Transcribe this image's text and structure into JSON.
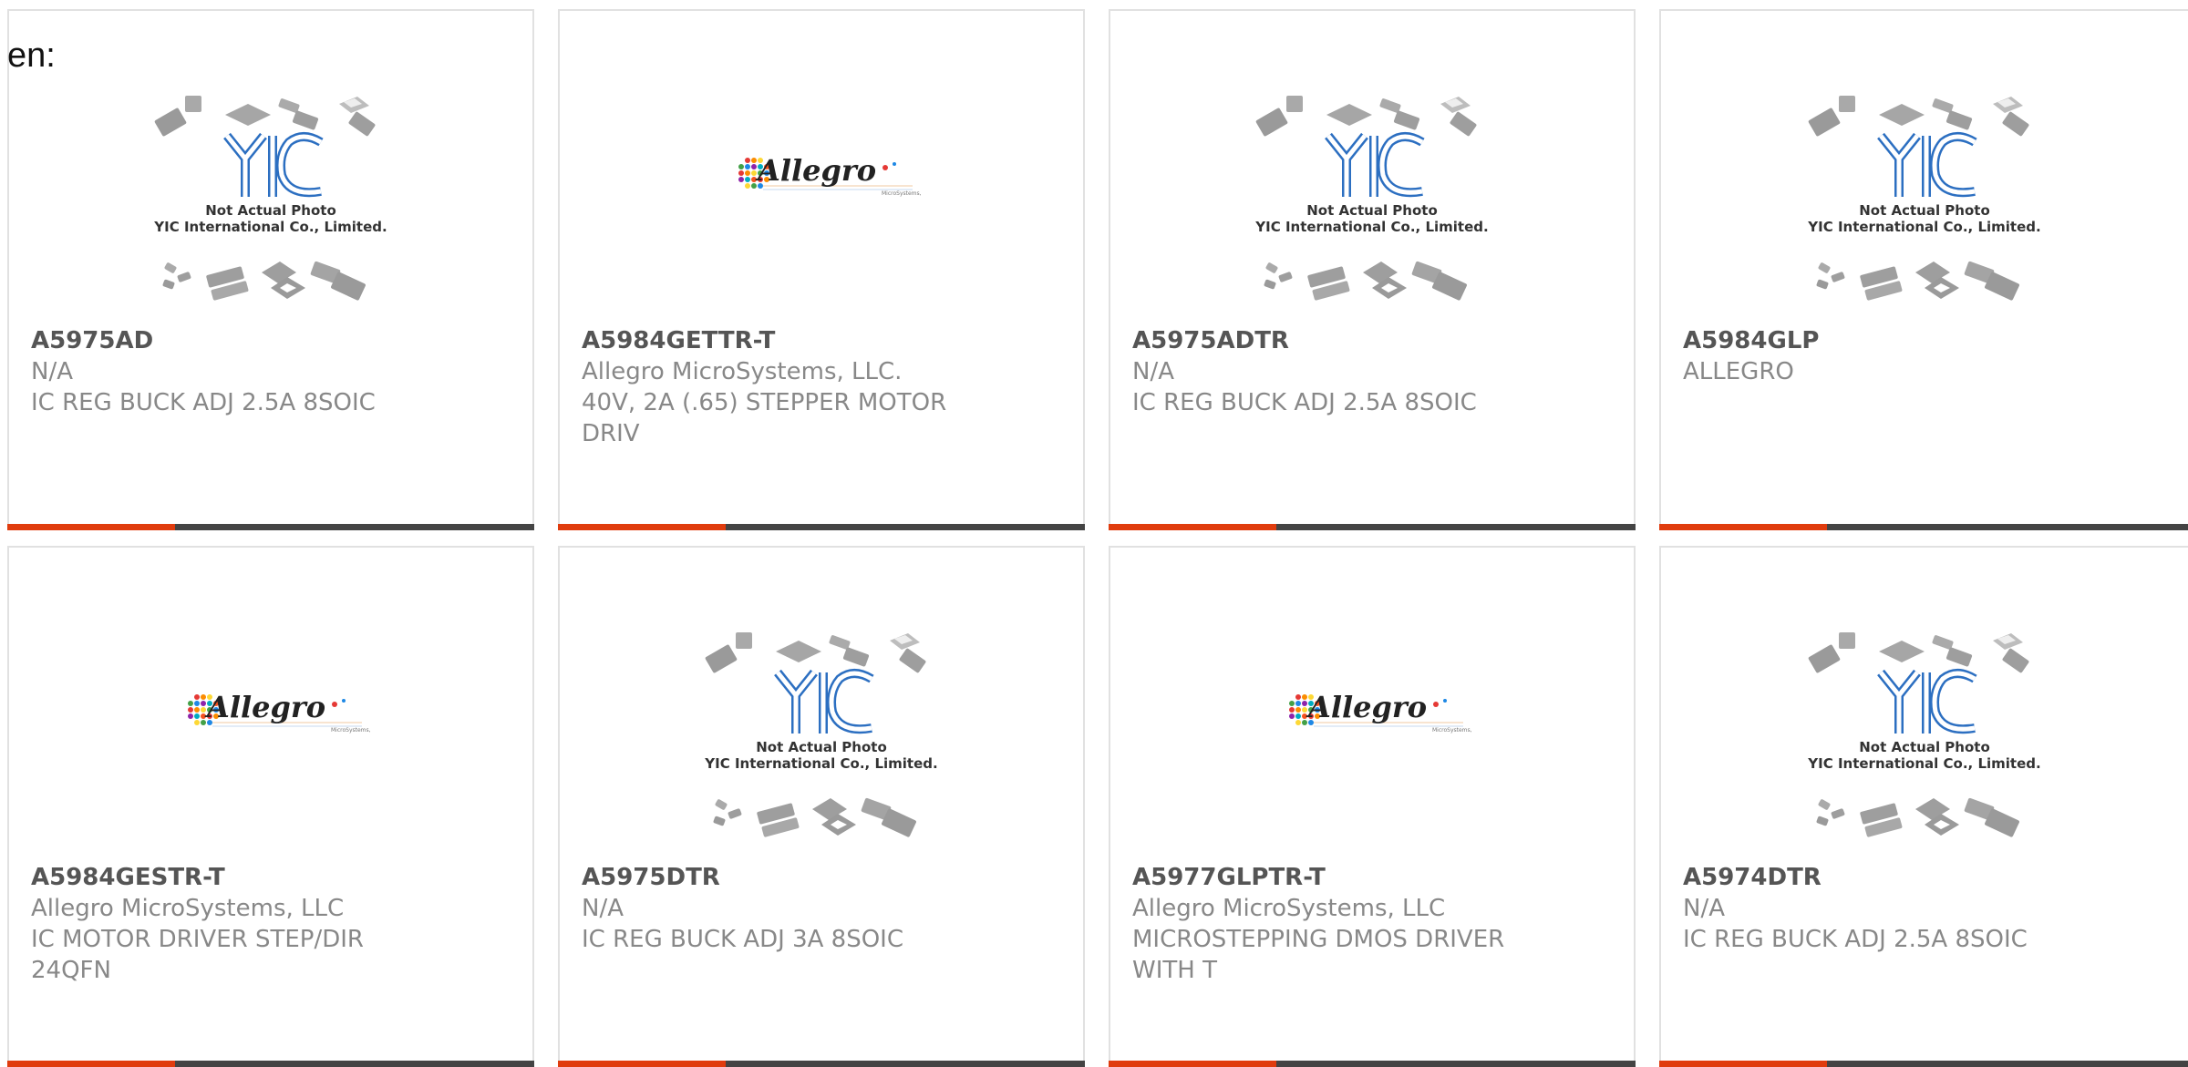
{
  "stub_label": "en:",
  "placeholder_image": {
    "caption_line1": "Not Actual Photo",
    "caption_line2": "YIC International Co., Limited.",
    "logo_text": "YIC"
  },
  "brand_logo": {
    "name": "Allegro",
    "tagline": "MicroSystems, LLC"
  },
  "colors": {
    "accent": "#e03c0e",
    "bar": "#444444",
    "logo_blue": "#2c6fc1"
  },
  "products": [
    {
      "part_number": "A5975AD",
      "manufacturer": "N/A",
      "description": "IC REG BUCK ADJ 2.5A 8SOIC",
      "image": "placeholder"
    },
    {
      "part_number": "A5984GETTR-T",
      "manufacturer": "Allegro MicroSystems, LLC.",
      "description": "40V, 2A (.65) STEPPER MOTOR DRIV",
      "image": "allegro"
    },
    {
      "part_number": "A5975ADTR",
      "manufacturer": "N/A",
      "description": "IC REG BUCK ADJ 2.5A 8SOIC",
      "image": "placeholder"
    },
    {
      "part_number": "A5984GLP",
      "manufacturer": "ALLEGRO",
      "description": "",
      "image": "placeholder"
    },
    {
      "part_number": "A5984GESTR-T",
      "manufacturer": "Allegro MicroSystems, LLC",
      "description": "IC MOTOR DRIVER STEP/DIR 24QFN",
      "image": "allegro"
    },
    {
      "part_number": "A5975DTR",
      "manufacturer": "N/A",
      "description": "IC REG BUCK ADJ 3A 8SOIC",
      "image": "placeholder"
    },
    {
      "part_number": "A5977GLPTR-T",
      "manufacturer": "Allegro MicroSystems, LLC",
      "description": "MICROSTEPPING DMOS DRIVER WITH T",
      "image": "allegro"
    },
    {
      "part_number": "A5974DTR",
      "manufacturer": "N/A",
      "description": "IC REG BUCK ADJ 2.5A 8SOIC",
      "image": "placeholder"
    }
  ]
}
